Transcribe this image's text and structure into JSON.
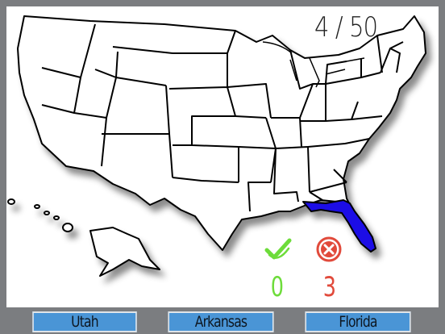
{
  "progress": "4 / 50",
  "score": {
    "correct": "0",
    "wrong": "3"
  },
  "highlighted_state": "Florida",
  "colors": {
    "highlight": "#1a10e6",
    "answer_button": "#4a95d6",
    "frame": "#7b7d80",
    "correct": "#6ddc3a",
    "wrong": "#e14a3b"
  },
  "answers": [
    "Utah",
    "Arkansas",
    "Florida"
  ],
  "icons": {
    "correct": "check-icon",
    "wrong": "x-circle-icon"
  }
}
